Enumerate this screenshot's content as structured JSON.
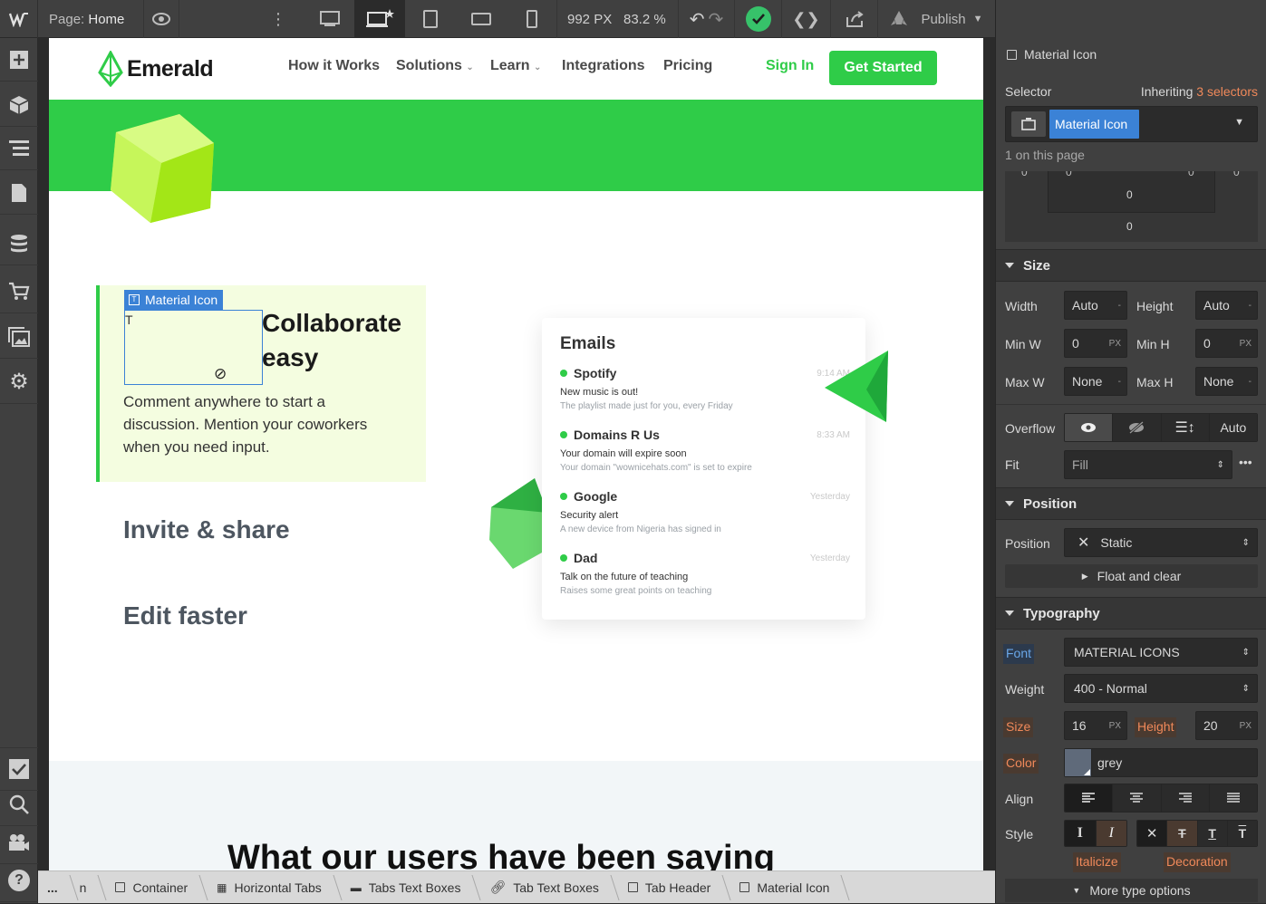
{
  "topbar": {
    "page_label": "Page:",
    "page_name": "Home",
    "viewport_px": "992 PX",
    "zoom": "83.2 %",
    "publish": "Publish"
  },
  "site": {
    "logo": "Emerald",
    "nav": [
      "How it Works",
      "Solutions",
      "Learn",
      "Integrations",
      "Pricing"
    ],
    "sign_in": "Sign In",
    "get_started": "Get Started",
    "tab1_title": "Collaborate easy",
    "tab1_title_l1": "Collaborate",
    "tab1_title_l2": "easy",
    "tab1_body_l1": "Comment anywhere to start a",
    "tab1_body_l2": "discussion. Mention your coworkers",
    "tab1_body_l3": "when you need input.",
    "tab2_title": "Invite & share",
    "tab3_title": "Edit faster",
    "selected_label": "Material Icon",
    "icon_glyph": "T",
    "section_heading": "What our users have been saying",
    "emails": {
      "title": "Emails",
      "items": [
        {
          "from": "Spotify",
          "time": "9:14 AM",
          "subject": "New music is out!",
          "preview": "The playlist made just for you, every Friday"
        },
        {
          "from": "Domains R Us",
          "time": "8:33 AM",
          "subject": "Your domain will expire soon",
          "preview": "Your domain \"wownicehats.com\" is set to expire"
        },
        {
          "from": "Google",
          "time": "Yesterday",
          "subject": "Security alert",
          "preview": "A new device from Nigeria has signed in"
        },
        {
          "from": "Dad",
          "time": "Yesterday",
          "subject": "Talk on the future of teaching",
          "preview": "Raises some great points on teaching"
        }
      ]
    }
  },
  "panel": {
    "element_type": "Material Icon",
    "selector_label": "Selector",
    "inheriting": "Inheriting",
    "inheriting_count": "3 selectors",
    "selector_chip": "Material Icon",
    "on_page": "1 on this page",
    "spacing_values": {
      "a": "0",
      "b": "0",
      "c": "0",
      "d": "0",
      "e": "0",
      "f": "0"
    },
    "size": {
      "title": "Size",
      "width_label": "Width",
      "width": "Auto",
      "height_label": "Height",
      "height": "Auto",
      "minw_label": "Min W",
      "minw": "0",
      "minh_label": "Min H",
      "minh": "0",
      "maxw_label": "Max W",
      "maxw": "None",
      "maxh_label": "Max H",
      "maxh": "None",
      "unit": "PX",
      "dash": "-",
      "overflow_label": "Overflow",
      "overflow_auto": "Auto",
      "fit_label": "Fit",
      "fit": "Fill"
    },
    "position": {
      "title": "Position",
      "label": "Position",
      "value": "Static",
      "float_clear": "Float and clear"
    },
    "typography": {
      "title": "Typography",
      "font_label": "Font",
      "font": "MATERIAL ICONS",
      "weight_label": "Weight",
      "weight": "400 - Normal",
      "size_label": "Size",
      "size": "16",
      "unit": "PX",
      "height_label": "Height",
      "height": "20",
      "color_label": "Color",
      "color_name": "grey",
      "color_swatch": "#5f6a7a",
      "align_label": "Align",
      "style_label": "Style",
      "italicize": "Italicize",
      "decoration": "Decoration",
      "more": "More type options"
    }
  },
  "breadcrumbs": [
    "...",
    "n",
    "Container",
    "Horizontal Tabs",
    "Tabs Text Boxes",
    "Tab Text Boxes",
    "Tab Header",
    "Material Icon"
  ],
  "colors": {
    "brand_green": "#2fcc48",
    "accent_blue": "#3b82d6",
    "highlight_orange": "#f0895a"
  }
}
